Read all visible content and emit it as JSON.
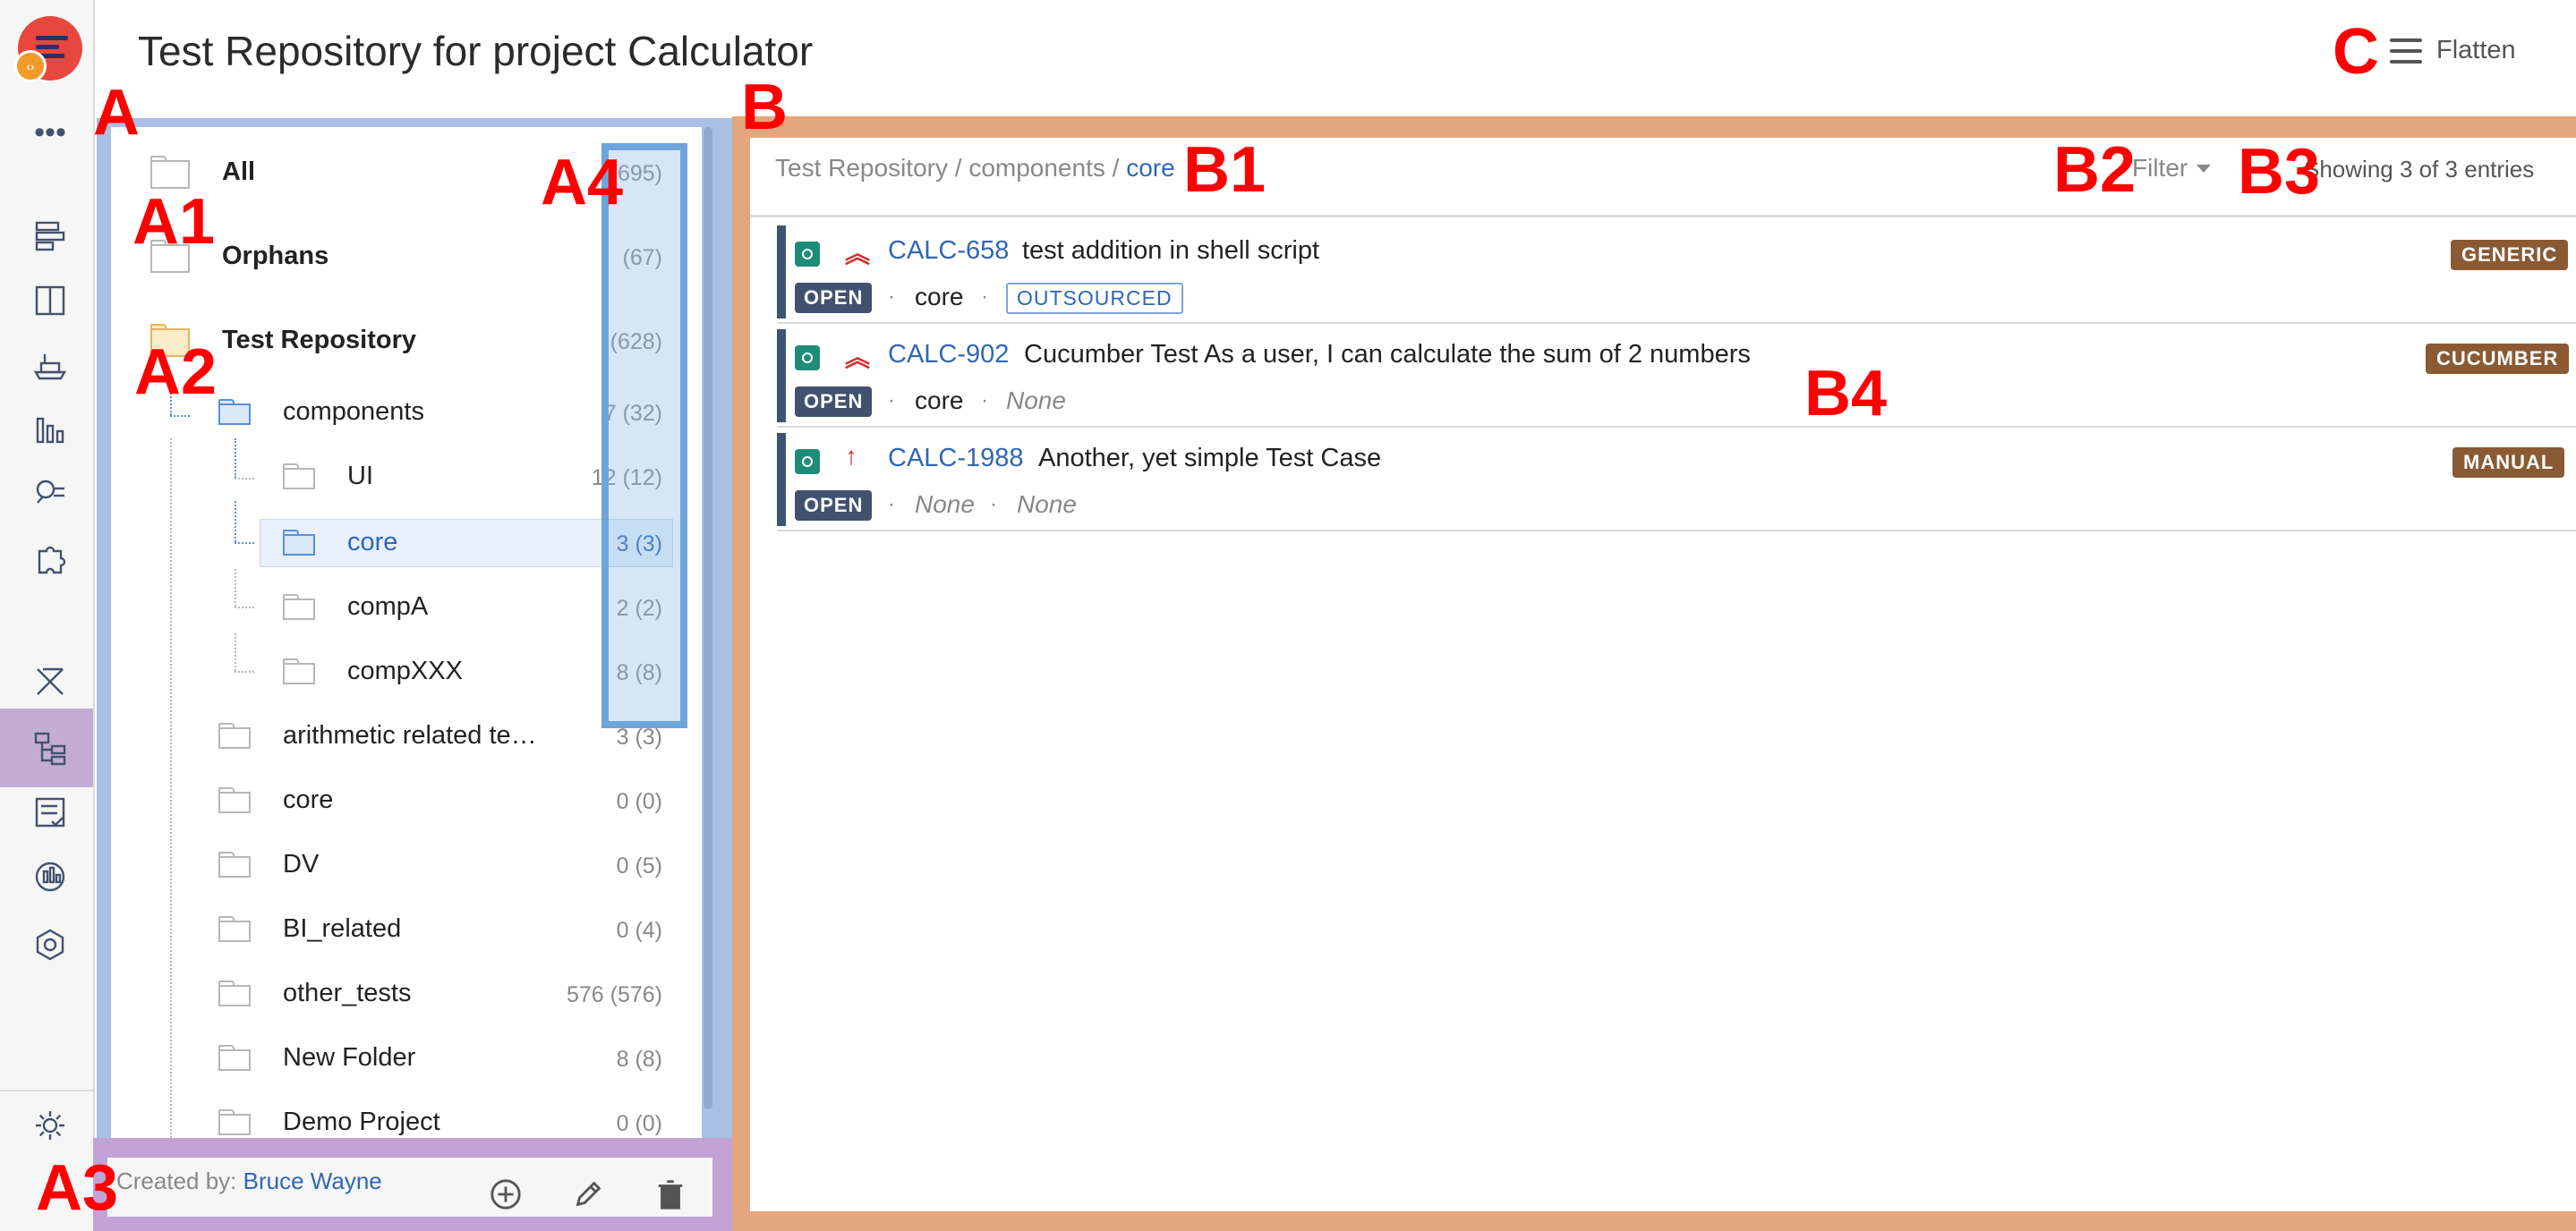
{
  "page": {
    "title": "Test Repository for project Calculator",
    "flatten_label": "Flatten"
  },
  "annotations": {
    "A": "A",
    "A1": "A1",
    "A2": "A2",
    "A3": "A3",
    "A4": "A4",
    "B": "B",
    "B1": "B1",
    "B2": "B2",
    "B3": "B3",
    "B4": "B4",
    "C": "C"
  },
  "sidebar_icons": [
    "app-logo",
    "more-icon",
    "board-icon",
    "split-icon",
    "ship-icon",
    "chart-icon",
    "search-icon",
    "puzzle-icon",
    "xray-icon",
    "test-repository-icon",
    "checklist-icon",
    "reports-icon",
    "hex-icon",
    "gear-icon"
  ],
  "tree": {
    "nodes": [
      {
        "label": "All",
        "count": "(695)"
      },
      {
        "label": "Orphans",
        "count": "(67)"
      },
      {
        "label": "Test Repository",
        "count": "(628)"
      },
      {
        "label": "components",
        "count": "7 (32)"
      },
      {
        "label": "UI",
        "count": "12 (12)"
      },
      {
        "label": "core",
        "count": "3 (3)"
      },
      {
        "label": "compA",
        "count": "2 (2)"
      },
      {
        "label": "compXXX",
        "count": "8 (8)"
      },
      {
        "label": "arithmetic related te…",
        "count": "3 (3)"
      },
      {
        "label": "core",
        "count": "0 (0)"
      },
      {
        "label": "DV",
        "count": "0 (5)"
      },
      {
        "label": "BI_related",
        "count": "0 (4)"
      },
      {
        "label": "other_tests",
        "count": "576 (576)"
      },
      {
        "label": "New Folder",
        "count": "8 (8)"
      },
      {
        "label": "Demo Project",
        "count": "0 (0)"
      }
    ],
    "footer": {
      "created_by_label": "Created by:",
      "created_by_user": "Bruce Wayne"
    }
  },
  "main": {
    "breadcrumb": {
      "root": "Test Repository",
      "sep": "/",
      "mid": "components",
      "current": "core"
    },
    "filter_label": "Filter",
    "showing": "Showing 3 of 3 entries",
    "tests": [
      {
        "key": "CALC-658",
        "summary": "test addition in shell script",
        "status": "OPEN",
        "component": "core",
        "label": "OUTSOURCED",
        "type": "GENERIC",
        "priority": "highest"
      },
      {
        "key": "CALC-902",
        "summary": "Cucumber Test As a user, I can calculate the sum of 2 numbers",
        "status": "OPEN",
        "component": "core",
        "label": "None",
        "type": "CUCUMBER",
        "priority": "highest"
      },
      {
        "key": "CALC-1988",
        "summary": "Another, yet simple Test Case",
        "status": "OPEN",
        "component": "None",
        "label": "None",
        "type": "MANUAL",
        "priority": "high"
      }
    ],
    "separator_dot": "·"
  },
  "colors": {
    "panel_a": "#a9bfe4",
    "panel_b": "#e3a67f",
    "annotation": "#ff0000",
    "link": "#2f67b5",
    "status_open": "#42526e",
    "test_type": "#8a5a35"
  }
}
